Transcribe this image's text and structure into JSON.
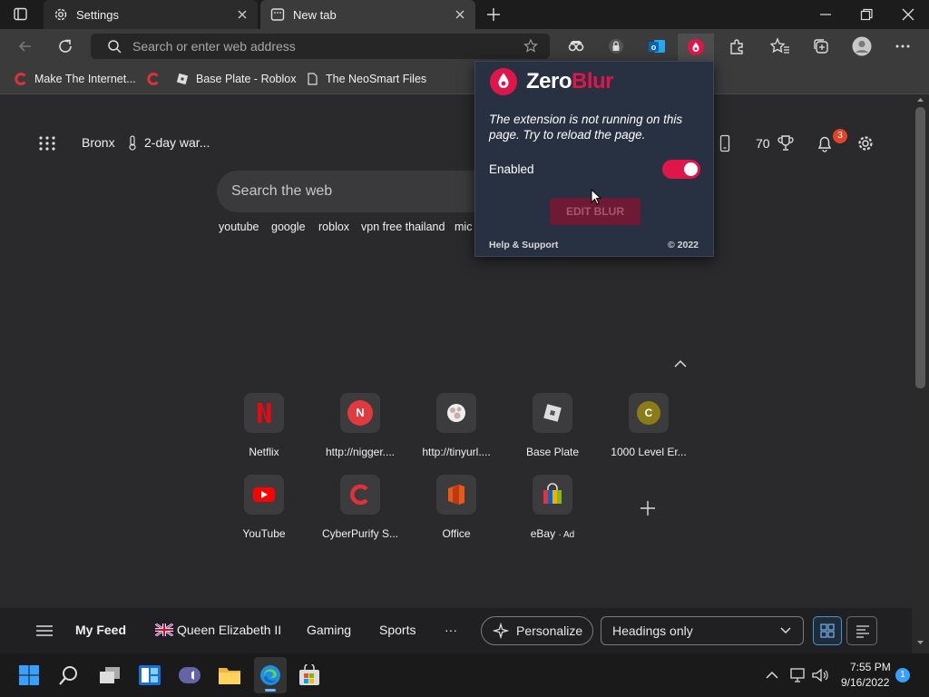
{
  "tabs": [
    {
      "label": "Settings"
    },
    {
      "label": "New tab"
    }
  ],
  "address_bar": {
    "placeholder": "Search or enter web address"
  },
  "bookmarks": [
    {
      "label": "Make The Internet..."
    },
    {
      "label": "Base Plate - Roblox"
    },
    {
      "label": "The NeoSmart Files"
    }
  ],
  "newtab": {
    "location": "Bronx",
    "weather": "2-day war...",
    "rewards_points": "70",
    "notification_count": "3",
    "search_placeholder": "Search the web",
    "suggestions": [
      "youtube",
      "google",
      "roblox",
      "vpn free thailand",
      "mic"
    ]
  },
  "quick_links": [
    {
      "label": "Netflix",
      "icon": "netflix-icon"
    },
    {
      "label": "http://nigger....",
      "icon": "letter-n-icon",
      "letter": "N"
    },
    {
      "label": "http://tinyurl....",
      "icon": "tinyurl-icon"
    },
    {
      "label": "Base Plate",
      "icon": "roblox-icon"
    },
    {
      "label": "1000 Level Er...",
      "icon": "letter-c-icon",
      "letter": "C"
    },
    {
      "label": "YouTube",
      "icon": "youtube-icon"
    },
    {
      "label": "CyberPurify S...",
      "icon": "cyberpurify-icon"
    },
    {
      "label": "Office",
      "icon": "office-icon"
    },
    {
      "label": "eBay",
      "icon": "ebay-icon",
      "ad_label": "· Ad"
    }
  ],
  "feed": {
    "items": [
      "My Feed",
      "Queen Elizabeth II",
      "Gaming",
      "Sports"
    ],
    "more": "···",
    "personalize": "Personalize",
    "layout_select": "Headings only"
  },
  "popup": {
    "brand_a": "Zero",
    "brand_b": "Blur",
    "message": "The extension is not running on this page. Try to reload the page.",
    "enabled_label": "Enabled",
    "enabled": true,
    "edit_button": "EDIT BLUR",
    "help": "Help & Support",
    "copyright": "© 2022"
  },
  "taskbar": {
    "time": "7:55 PM",
    "date": "9/16/2022",
    "badge": "1"
  },
  "colors": {
    "accent": "#e0164a",
    "popup_bg": "#273142",
    "edge_blue": "#0a84ff"
  }
}
